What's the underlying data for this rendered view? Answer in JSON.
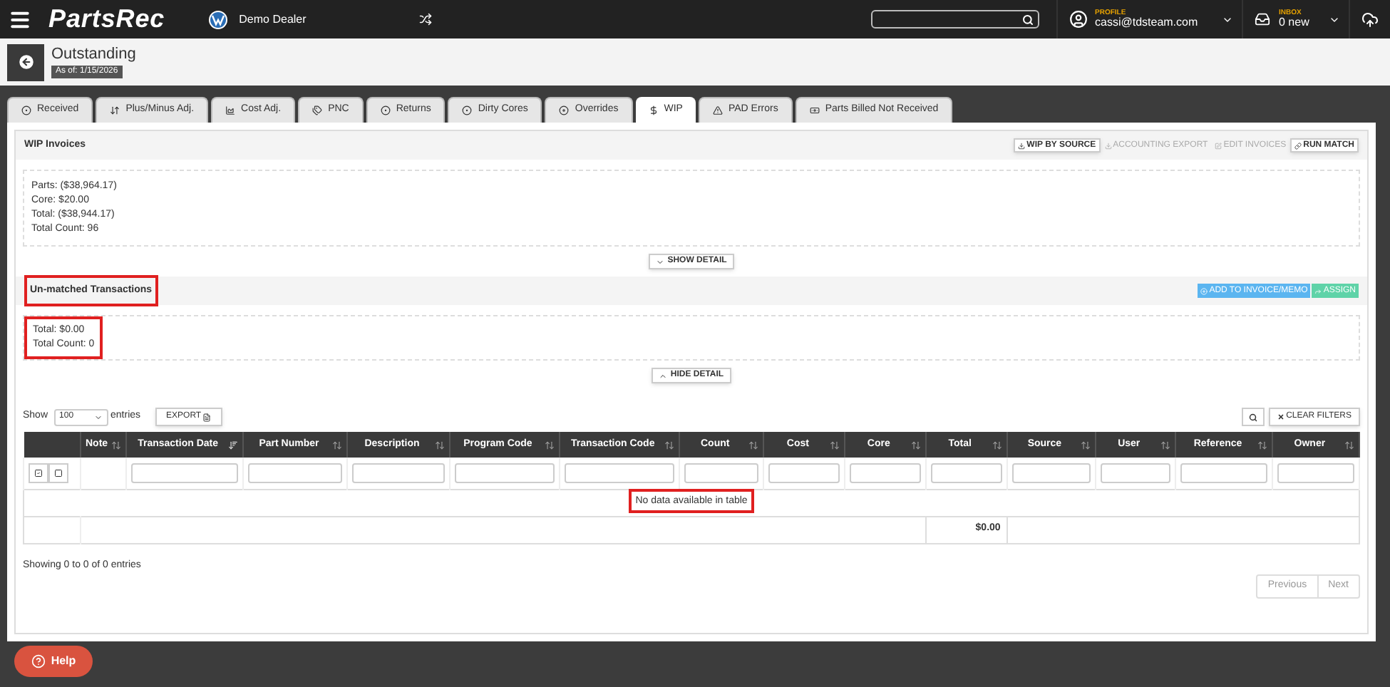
{
  "topbar": {
    "brand": "PartsRec",
    "dealer": "Demo Dealer",
    "profile_label": "PROFILE",
    "profile_email": "cassi@tdsteam.com",
    "inbox_label": "INBOX",
    "inbox_count": "0 new"
  },
  "header": {
    "title": "Outstanding",
    "as_of": "As of: 1/15/2026"
  },
  "tabs": [
    {
      "label": "Received",
      "selected": false
    },
    {
      "label": "Plus/Minus Adj.",
      "selected": false
    },
    {
      "label": "Cost Adj.",
      "selected": false
    },
    {
      "label": "PNC",
      "selected": false
    },
    {
      "label": "Returns",
      "selected": false
    },
    {
      "label": "Dirty Cores",
      "selected": false
    },
    {
      "label": "Overrides",
      "selected": false
    },
    {
      "label": "WIP",
      "selected": true
    },
    {
      "label": "PAD Errors",
      "selected": false
    },
    {
      "label": "Parts Billed Not Received",
      "selected": false
    }
  ],
  "wip": {
    "title": "WIP Invoices",
    "actions": [
      {
        "label": "WIP BY SOURCE",
        "disabled": false
      },
      {
        "label": "ACCOUNTING EXPORT",
        "disabled": true
      },
      {
        "label": "EDIT INVOICES",
        "disabled": true
      },
      {
        "label": "RUN MATCH",
        "disabled": false
      }
    ],
    "summary": [
      "Parts: ($38,964.17)",
      "Core: $20.00",
      "Total: ($38,944.17)",
      "Total Count: 96"
    ],
    "toggle": "SHOW DETAIL",
    "toggle_expanded": false
  },
  "unmatched": {
    "title": "Un-matched Transactions",
    "highlighted": true,
    "actions": [
      {
        "label": "ADD TO INVOICE/MEMO",
        "kind": "primary"
      },
      {
        "label": "ASSIGN",
        "kind": "success"
      }
    ],
    "summary": [
      "Total: $0.00",
      "Total Count: 0"
    ],
    "summary_highlighted": true,
    "toggle": "HIDE DETAIL",
    "toggle_expanded": true
  },
  "table": {
    "show_label": "Show",
    "page_size": "100",
    "entries_label": "entries",
    "export": "EXPORT",
    "clear_filters": "CLEAR FILTERS",
    "columns": [
      {
        "label": "Note",
        "sorted": false
      },
      {
        "label": "Transaction Date",
        "sorted": true
      },
      {
        "label": "Part Number",
        "sorted": false
      },
      {
        "label": "Description",
        "sorted": false
      },
      {
        "label": "Program Code",
        "sorted": false
      },
      {
        "label": "Transaction Code",
        "sorted": false
      },
      {
        "label": "Count",
        "sorted": false
      },
      {
        "label": "Cost",
        "sorted": false
      },
      {
        "label": "Core",
        "sorted": false
      },
      {
        "label": "Total",
        "sorted": false,
        "footer": "$0.00"
      },
      {
        "label": "Source",
        "sorted": false
      },
      {
        "label": "User",
        "sorted": false
      },
      {
        "label": "Reference",
        "sorted": false
      },
      {
        "label": "Owner",
        "sorted": false
      }
    ],
    "empty_message": "No data available in table",
    "empty_highlighted": true,
    "info": "Showing 0 to 0 of 0 entries",
    "pagination": [
      {
        "label": "Previous",
        "disabled": true
      },
      {
        "label": "Next",
        "disabled": true
      }
    ]
  },
  "help": "Help"
}
